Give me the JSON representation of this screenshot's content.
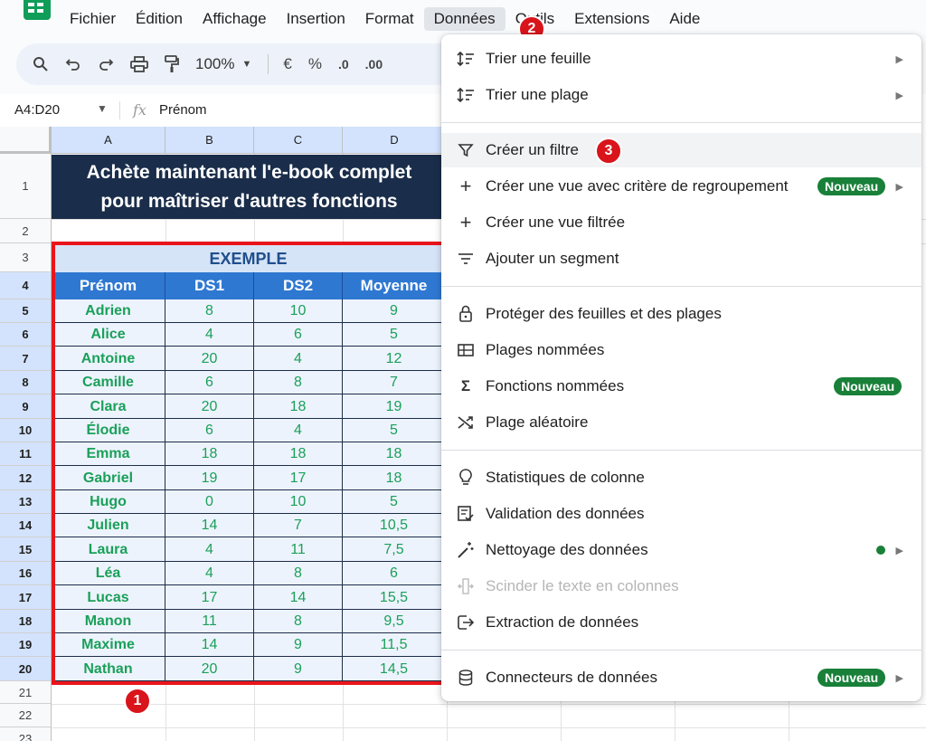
{
  "menubar": {
    "items": [
      "Fichier",
      "Édition",
      "Affichage",
      "Insertion",
      "Format",
      "Données",
      "Outils",
      "Extensions",
      "Aide"
    ]
  },
  "toolbar": {
    "zoom": "100%",
    "currency_label": "€",
    "percent_label": "%",
    "decimal_decrease_label": ".0",
    "decimal_increase_label": ".00"
  },
  "formula_bar": {
    "name_box": "A4:D20",
    "fx_label": "fx",
    "value": "Prénom"
  },
  "sheet": {
    "columns": [
      "A",
      "B",
      "C",
      "D"
    ],
    "rows": [
      "1",
      "2",
      "3",
      "4",
      "5",
      "6",
      "7",
      "8",
      "9",
      "10",
      "11",
      "12",
      "13",
      "14",
      "15",
      "16",
      "17",
      "18",
      "19",
      "20",
      "21",
      "22",
      "23"
    ],
    "banner_line1": "Achète maintenant l'e-book complet",
    "banner_line2": "pour maîtriser d'autres fonctions",
    "table_title": "EXEMPLE",
    "headers": [
      "Prénom",
      "DS1",
      "DS2",
      "Moyenne"
    ],
    "data": [
      [
        "Adrien",
        "8",
        "10",
        "9"
      ],
      [
        "Alice",
        "4",
        "6",
        "5"
      ],
      [
        "Antoine",
        "20",
        "4",
        "12"
      ],
      [
        "Camille",
        "6",
        "8",
        "7"
      ],
      [
        "Clara",
        "20",
        "18",
        "19"
      ],
      [
        "Élodie",
        "6",
        "4",
        "5"
      ],
      [
        "Emma",
        "18",
        "18",
        "18"
      ],
      [
        "Gabriel",
        "19",
        "17",
        "18"
      ],
      [
        "Hugo",
        "0",
        "10",
        "5"
      ],
      [
        "Julien",
        "14",
        "7",
        "10,5"
      ],
      [
        "Laura",
        "4",
        "11",
        "7,5"
      ],
      [
        "Léa",
        "4",
        "8",
        "6"
      ],
      [
        "Lucas",
        "17",
        "14",
        "15,5"
      ],
      [
        "Manon",
        "11",
        "8",
        "9,5"
      ],
      [
        "Maxime",
        "14",
        "9",
        "11,5"
      ],
      [
        "Nathan",
        "20",
        "9",
        "14,5"
      ]
    ]
  },
  "badges": {
    "one": "1",
    "two": "2",
    "three": "3"
  },
  "dropdown": {
    "items": [
      {
        "label": "Trier une feuille",
        "icon": "sort-icon",
        "submenu": true
      },
      {
        "label": "Trier une plage",
        "icon": "sort-icon",
        "submenu": true
      },
      {
        "label": "Créer un filtre",
        "icon": "filter-icon"
      },
      {
        "label": "Créer une vue avec critère de regroupement",
        "icon": "plus-icon",
        "submenu": true,
        "badge": "Nouveau"
      },
      {
        "label": "Créer une vue filtrée",
        "icon": "plus-icon"
      },
      {
        "label": "Ajouter un segment",
        "icon": "slicer-icon"
      },
      {
        "label": "Protéger des feuilles et des plages",
        "icon": "lock-icon"
      },
      {
        "label": "Plages nommées",
        "icon": "named-ranges-icon"
      },
      {
        "label": "Fonctions nommées",
        "icon": "sigma-icon",
        "badge": "Nouveau"
      },
      {
        "label": "Plage aléatoire",
        "icon": "shuffle-icon"
      },
      {
        "label": "Statistiques de colonne",
        "icon": "lightbulb-icon"
      },
      {
        "label": "Validation des données",
        "icon": "validation-icon"
      },
      {
        "label": "Nettoyage des données",
        "icon": "magic-wand-icon",
        "submenu": true
      },
      {
        "label": "Scinder le texte en colonnes",
        "icon": "split-icon",
        "disabled": true
      },
      {
        "label": "Extraction de données",
        "icon": "extract-icon"
      },
      {
        "label": "Connecteurs de données",
        "icon": "database-icon",
        "submenu": true,
        "badge": "Nouveau"
      }
    ]
  },
  "colors": {
    "accent_red": "#e8161c",
    "header_blue": "#2f78d2",
    "banner_navy": "#1a2d4a",
    "value_green": "#1aa05a",
    "badge_green": "#188038"
  }
}
